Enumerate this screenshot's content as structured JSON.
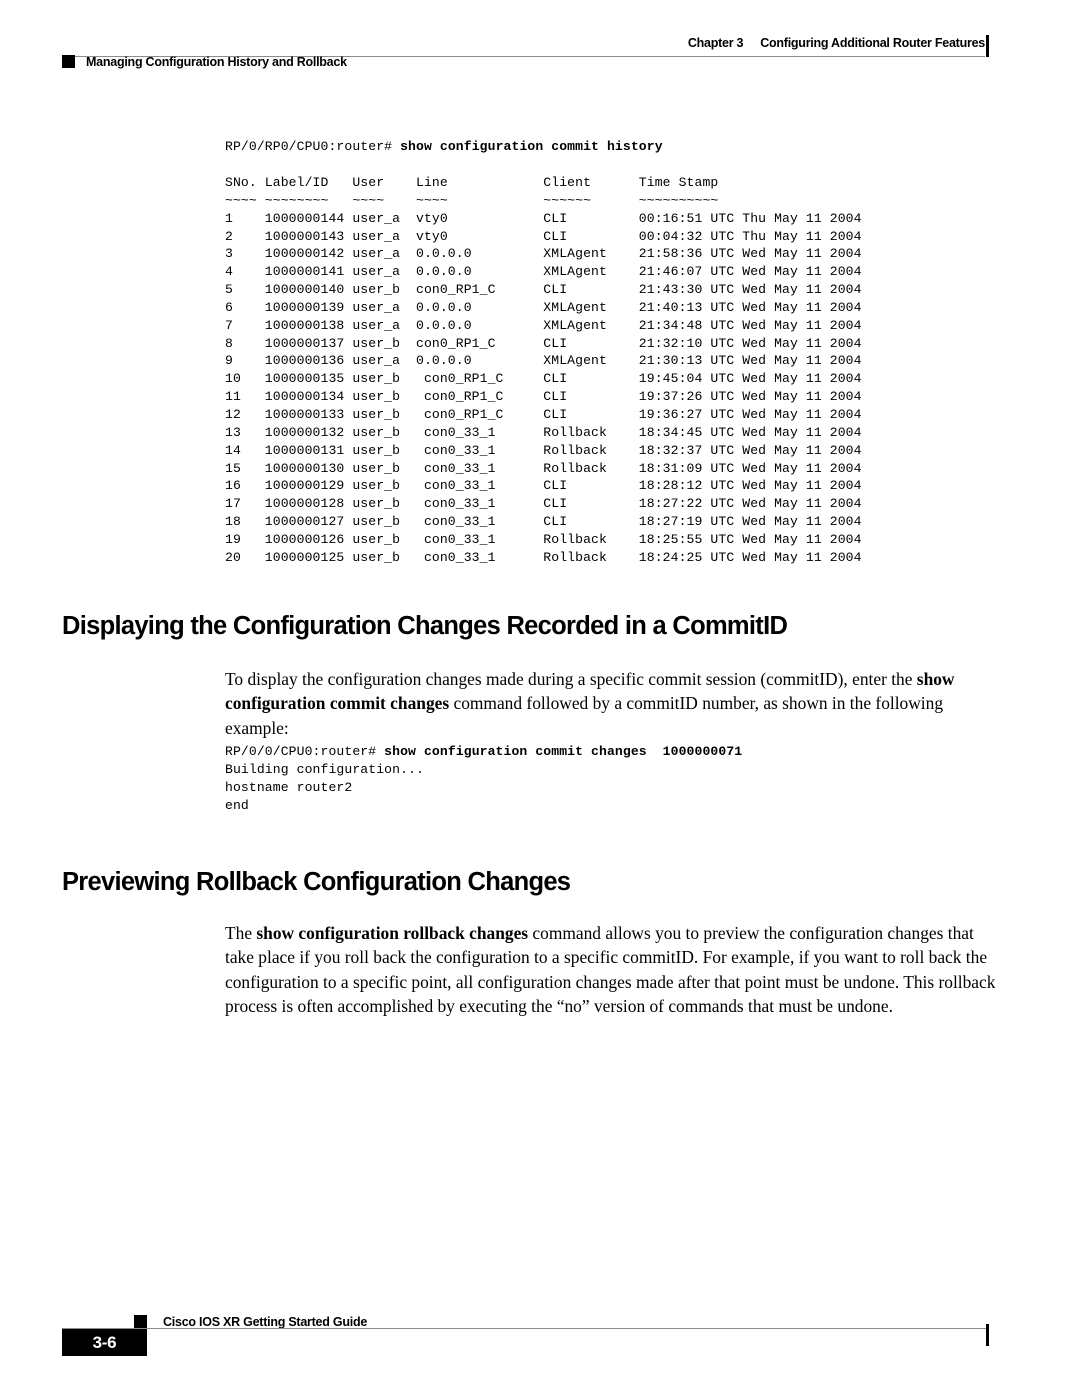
{
  "page": {
    "chapter_label": "Chapter 3",
    "chapter_title": "Configuring Additional Router Features",
    "section_running_head": "Managing Configuration History and Rollback",
    "page_number": "3-6",
    "guide_title": "Cisco IOS XR Getting Started Guide"
  },
  "commit_history_example": {
    "prompt": "RP/0/RP0/CPU0:router# ",
    "command": "show configuration commit history",
    "columns": [
      "SNo.",
      "Label/ID",
      "User",
      "Line",
      "Client",
      "Time Stamp"
    ],
    "rule_row": "~~~~ ~~~~~~~~ ~~~~ ~~~~ ~~~~~~ ~~~~~~~~~~",
    "header_row": "SNo. Label/ID   User    Line      Client    Time Stamp",
    "rows": [
      {
        "sno": "1",
        "label_id": "1000000144",
        "user": "user_a",
        "line": "vty0",
        "client": "CLI",
        "time_stamp": "00:16:51 UTC Thu May 11 2004"
      },
      {
        "sno": "2",
        "label_id": "1000000143",
        "user": "user_a",
        "line": "vty0",
        "client": "CLI",
        "time_stamp": "00:04:32 UTC Thu May 11 2004"
      },
      {
        "sno": "3",
        "label_id": "1000000142",
        "user": "user_a",
        "line": "0.0.0.0",
        "client": "XMLAgent",
        "time_stamp": "21:58:36 UTC Wed May 11 2004"
      },
      {
        "sno": "4",
        "label_id": "1000000141",
        "user": "user_a",
        "line": "0.0.0.0",
        "client": "XMLAgent",
        "time_stamp": "21:46:07 UTC Wed May 11 2004"
      },
      {
        "sno": "5",
        "label_id": "1000000140",
        "user": "user_b",
        "line": "con0_RP1_C",
        "client": "CLI",
        "time_stamp": "21:43:30 UTC Wed May 11 2004"
      },
      {
        "sno": "6",
        "label_id": "1000000139",
        "user": "user_a",
        "line": "0.0.0.0",
        "client": "XMLAgent",
        "time_stamp": "21:40:13 UTC Wed May 11 2004"
      },
      {
        "sno": "7",
        "label_id": "1000000138",
        "user": "user_a",
        "line": "0.0.0.0",
        "client": "XMLAgent",
        "time_stamp": "21:34:48 UTC Wed May 11 2004"
      },
      {
        "sno": "8",
        "label_id": "1000000137",
        "user": "user_b",
        "line": "con0_RP1_C",
        "client": "CLI",
        "time_stamp": "21:32:10 UTC Wed May 11 2004"
      },
      {
        "sno": "9",
        "label_id": "1000000136",
        "user": "user_a",
        "line": "0.0.0.0",
        "client": "XMLAgent",
        "time_stamp": "21:30:13 UTC Wed May 11 2004"
      },
      {
        "sno": "10",
        "label_id": "1000000135",
        "user": "user_b",
        "line": "con0_RP1_C",
        "client": "CLI",
        "time_stamp": "19:45:04 UTC Wed May 11 2004"
      },
      {
        "sno": "11",
        "label_id": "1000000134",
        "user": "user_b",
        "line": "con0_RP1_C",
        "client": "CLI",
        "time_stamp": "19:37:26 UTC Wed May 11 2004"
      },
      {
        "sno": "12",
        "label_id": "1000000133",
        "user": "user_b",
        "line": "con0_RP1_C",
        "client": "CLI",
        "time_stamp": "19:36:27 UTC Wed May 11 2004"
      },
      {
        "sno": "13",
        "label_id": "1000000132",
        "user": "user_b",
        "line": "con0_33_1",
        "client": "Rollback",
        "time_stamp": "18:34:45 UTC Wed May 11 2004"
      },
      {
        "sno": "14",
        "label_id": "1000000131",
        "user": "user_b",
        "line": "con0_33_1",
        "client": "Rollback",
        "time_stamp": "18:32:37 UTC Wed May 11 2004"
      },
      {
        "sno": "15",
        "label_id": "1000000130",
        "user": "user_b",
        "line": "con0_33_1",
        "client": "Rollback",
        "time_stamp": "18:31:09 UTC Wed May 11 2004"
      },
      {
        "sno": "16",
        "label_id": "1000000129",
        "user": "user_b",
        "line": "con0_33_1",
        "client": "CLI",
        "time_stamp": "18:28:12 UTC Wed May 11 2004"
      },
      {
        "sno": "17",
        "label_id": "1000000128",
        "user": "user_b",
        "line": "con0_33_1",
        "client": "CLI",
        "time_stamp": "18:27:22 UTC Wed May 11 2004"
      },
      {
        "sno": "18",
        "label_id": "1000000127",
        "user": "user_b",
        "line": "con0_33_1",
        "client": "CLI",
        "time_stamp": "18:27:19 UTC Wed May 11 2004"
      },
      {
        "sno": "19",
        "label_id": "1000000126",
        "user": "user_b",
        "line": "con0_33_1",
        "client": "Rollback",
        "time_stamp": "18:25:55 UTC Wed May 11 2004"
      },
      {
        "sno": "20",
        "label_id": "1000000125",
        "user": "user_b",
        "line": "con0_33_1",
        "client": "Rollback",
        "time_stamp": "18:24:25 UTC Wed May 11 2004"
      }
    ]
  },
  "section_commitid": {
    "heading": "Displaying the Configuration Changes Recorded in a CommitID",
    "paragraph_part1": "To display the configuration changes made during a specific commit session (commitID), enter the ",
    "paragraph_bold1": "show configuration commit changes",
    "paragraph_part2": " command followed by a commitID number, as shown in the following example:",
    "example": {
      "prompt": "RP/0/0/CPU0:router# ",
      "command": "show configuration commit changes  1000000071",
      "output_lines": [
        "Building configuration...",
        "hostname router2",
        "end"
      ]
    }
  },
  "section_rollback": {
    "heading": "Previewing Rollback Configuration Changes",
    "paragraph_part1": "The ",
    "paragraph_bold1": "show configuration rollback changes",
    "paragraph_part2": " command allows you to preview the configuration changes that take place if you roll back the configuration to a specific commitID. For example, if you want to roll back the configuration to a specific point, all configuration changes made after that point must be undone. This rollback process is often accomplished by executing the “no” version of commands that must be undone."
  }
}
